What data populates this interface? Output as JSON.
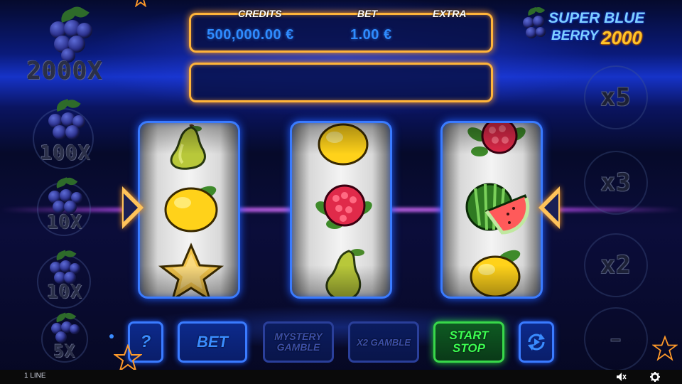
{
  "game": {
    "logo": {
      "line1": "SUPER BLUE",
      "line2": "BERRY",
      "number": "2000",
      "line1_color": "#7fd0ff",
      "number_color": "#ffc42a"
    }
  },
  "info_panel": {
    "credits_label": "CREDITS",
    "credits_value": "500,000.00 €",
    "bet_label": "BET",
    "bet_value": "1.00 €",
    "extra_label": "EXTRA",
    "extra_value": "",
    "message": ""
  },
  "paytable": [
    {
      "label": "2000X"
    },
    {
      "label": "100X"
    },
    {
      "label": "10X"
    },
    {
      "label": "10X"
    },
    {
      "label": "5X"
    }
  ],
  "multipliers": [
    {
      "label": "x5"
    },
    {
      "label": "x3"
    },
    {
      "label": "x2"
    },
    {
      "label": "–"
    }
  ],
  "reels": [
    {
      "symbols": [
        "pear",
        "lemon",
        "star"
      ]
    },
    {
      "symbols": [
        "lemon",
        "raspberry",
        "pear"
      ]
    },
    {
      "symbols": [
        "raspberry",
        "watermelon",
        "lemon"
      ]
    }
  ],
  "buttons": {
    "help": "?",
    "bet": "BET",
    "mystery_gamble_line1": "MYSTERY",
    "mystery_gamble_line2": "GAMBLE",
    "x2_gamble": "X2 GAMBLE",
    "start_line1": "START",
    "stop_line2": "STOP",
    "autoplay_icon": "refresh-play-icon"
  },
  "bottom_bar": {
    "lines_label": "1 LINE",
    "sound_icon": "speaker-muted-icon",
    "settings_icon": "gear-icon"
  },
  "colors": {
    "panel_border": "#ffb43a",
    "reel_border": "#3a7bff",
    "start_button": "#38d84a",
    "value_text": "#2f8cff"
  }
}
